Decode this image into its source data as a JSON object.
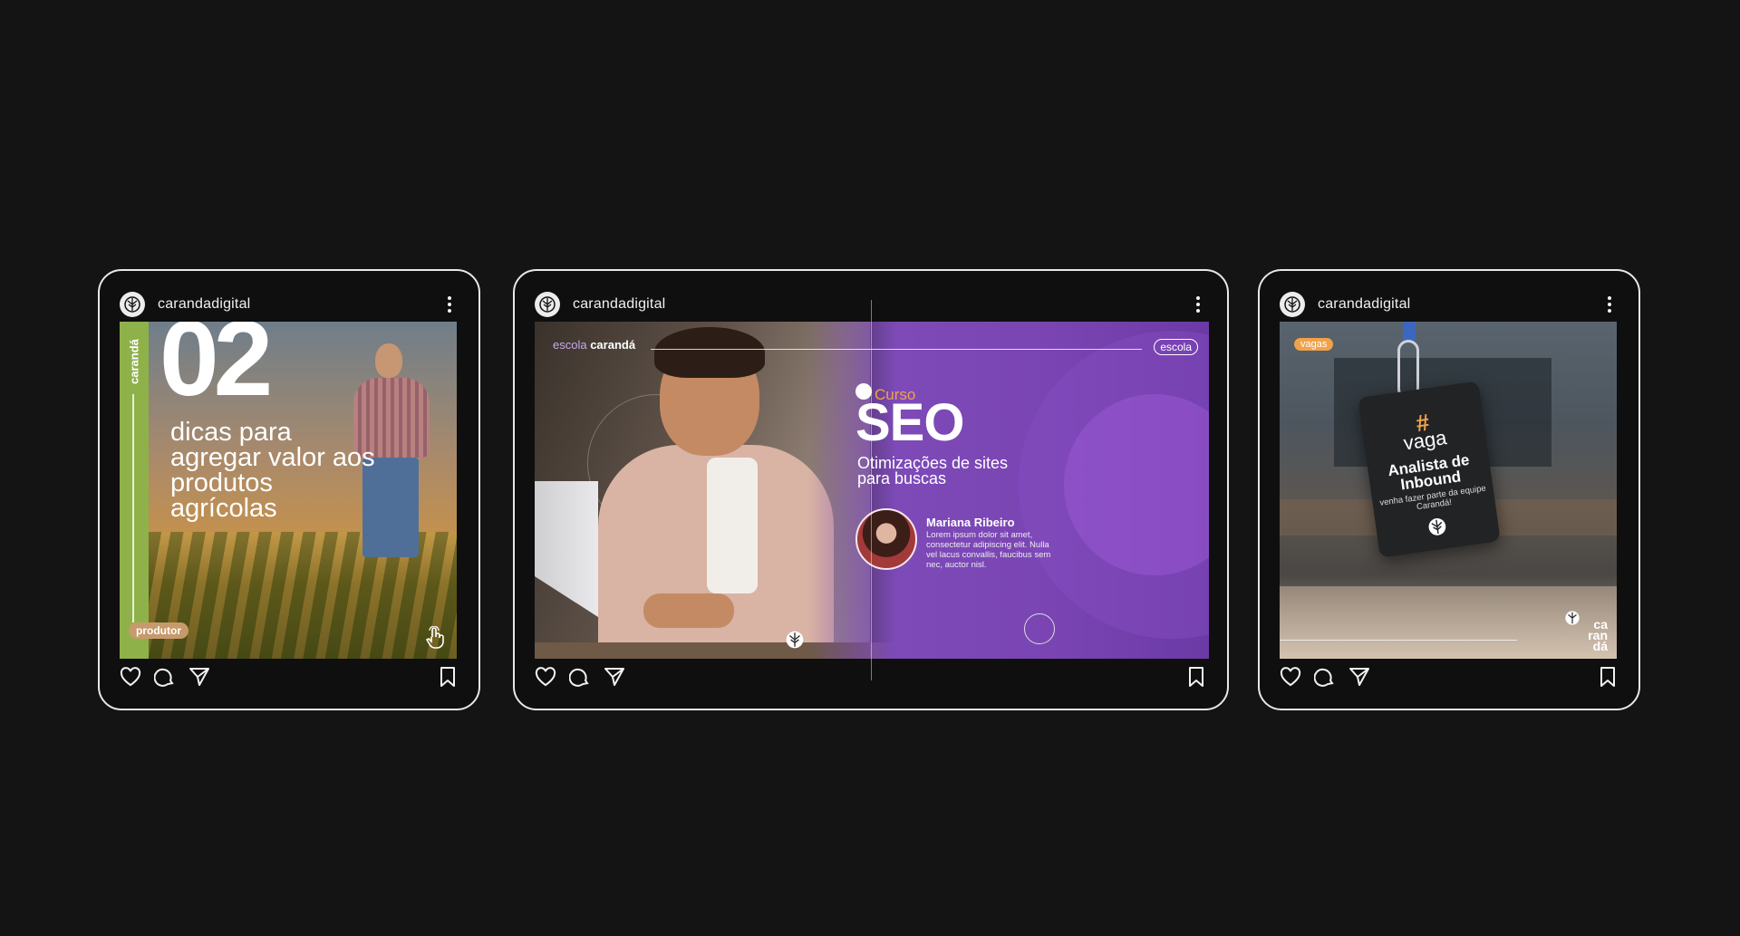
{
  "cards": [
    {
      "username": "carandadigital",
      "post": {
        "brand_vertical": "carandá",
        "number": "02",
        "headline": "dicas para agregar valor aos produtos agrícolas",
        "badge": "produtor"
      }
    },
    {
      "username": "carandadigital",
      "post": {
        "school_prefix": "escola",
        "school_name": "carandá",
        "school_pill": "escola",
        "course_label": "Curso",
        "course_title": "SEO",
        "course_subtitle": "Otimizações de sites para buscas",
        "speaker_name": "Mariana Ribeiro",
        "speaker_bio": "Lorem ipsum dolor sit amet, consectetur adipiscing elit. Nulla vel lacus convallis, faucibus sem nec, auctor nisl."
      }
    },
    {
      "username": "carandadigital",
      "post": {
        "badge": "vagas",
        "hash": "#",
        "tag_title": "vaga",
        "role": "Analista de Inbound",
        "tag_sub": "venha fazer parte da equipe Carandá!",
        "brand_l1": "ca",
        "brand_l2": "ran",
        "brand_l3": "dá"
      }
    }
  ],
  "icons": [
    "logo-icon",
    "more-icon",
    "heart-icon",
    "comment-icon",
    "share-icon",
    "bookmark-icon",
    "tap-icon"
  ],
  "colors": {
    "background": "#141414",
    "card_border": "#e8e8e8",
    "green": "#8fb14a",
    "purple": "#7d4ab8",
    "orange": "#f0a24a"
  }
}
